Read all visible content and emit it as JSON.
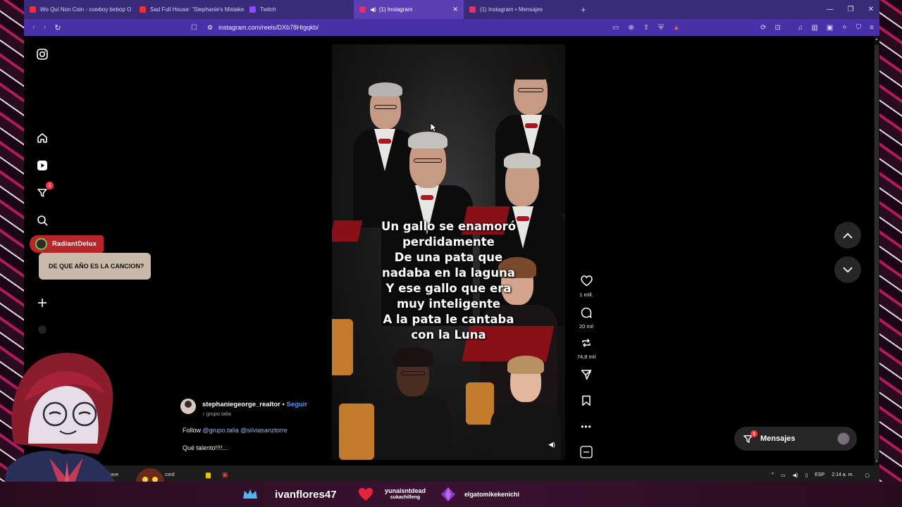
{
  "browser": {
    "tabs": [
      {
        "title": "Wo Qui Non Coin - cowboy bebop O",
        "favicon_color": "#ff2a2a",
        "active": false
      },
      {
        "title": "Sad Full House: \"Stephanie's Mistake",
        "favicon_color": "#ff2a2a",
        "active": false
      },
      {
        "title": "Twitch",
        "favicon_color": "#9146ff",
        "active": false
      },
      {
        "title": "(1) Instagram",
        "favicon_color": "#e1306c",
        "active": true
      },
      {
        "title": "(1) Instagram • Mensajes",
        "favicon_color": "#e1306c",
        "active": false
      }
    ],
    "url": "instagram.com/reels/DXb78Htgqkb/"
  },
  "sidebar": {
    "notifications_badge": "1"
  },
  "reel": {
    "lyrics": [
      "Un gallo se enamoró",
      "perdidamente",
      "De una pata que",
      "nadaba en la laguna",
      "Y ese gallo que era",
      "muy inteligente",
      "A la pata le cantaba",
      "con la Luna"
    ],
    "likes": "1 mill.",
    "comments": "20 mil",
    "reposts": "74,8 mil",
    "author": "stephaniegeorge_realtor",
    "follow_label": "Seguir",
    "audio": "grupo.talia",
    "caption_prefix": "Follow",
    "mention_1": "@grupo.talia",
    "mention_2": "@silviasanztorre",
    "caption_line2": "Qué talento!!!!..."
  },
  "messages": {
    "label": "Mensajes",
    "badge": "1"
  },
  "taskbar": {
    "brave_label": "Brave",
    "discord_label": "cord",
    "lang": "ESP",
    "time": "2:14 a. m."
  },
  "overlay": {
    "chat_user": "RadiantDelux",
    "chat_message": "DE QUE AÑO ES LA CANCION?",
    "alert_user_1": "ivanflores47",
    "alert_user_2": "yunaisntdead",
    "alert_user_2_sub": "sukachilleng",
    "alert_user_3": "elgatomikekenichi"
  }
}
